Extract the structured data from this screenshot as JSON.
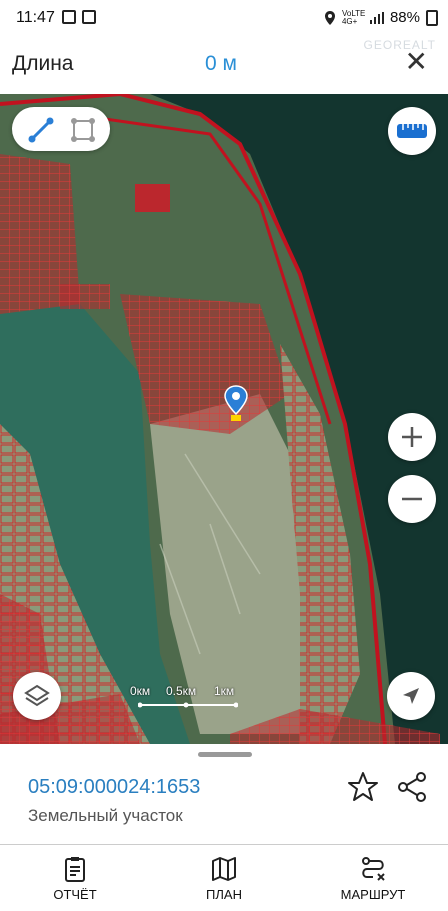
{
  "status_bar": {
    "time": "11:47",
    "network": "VoLTE 4G+",
    "battery": "88%"
  },
  "header": {
    "title": "Длина",
    "length_value": "0 м",
    "watermark": "GEOREALT"
  },
  "map": {
    "tools": {
      "line": "line-measure-icon",
      "polygon": "area-measure-icon"
    },
    "scale_labels": [
      "0км",
      "0.5км",
      "1км"
    ],
    "colors": {
      "parcel_outline": "#cc1f2a",
      "parcel_fill": "#d6212a",
      "sea": "#123a33",
      "water": "#3b7a68",
      "marker": "#2a7fd6"
    }
  },
  "parcel": {
    "cadastral_number": "05:09:000024:1653",
    "type": "Земельный участок"
  },
  "nav": {
    "report": "ОТЧЁТ",
    "plan": "ПЛАН",
    "route": "МАРШРУТ"
  }
}
